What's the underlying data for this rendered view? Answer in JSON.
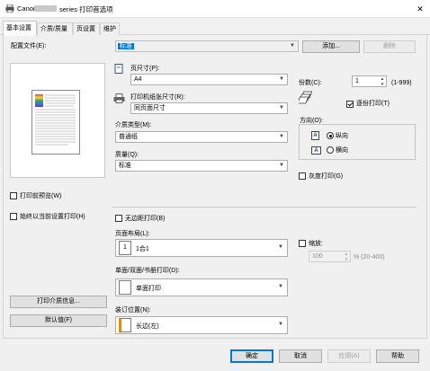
{
  "window": {
    "title_prefix": "Canon",
    "title_suffix": "series 打印首选项",
    "close_glyph": "✕"
  },
  "tabs": [
    {
      "label": "基本设置",
      "active": true
    },
    {
      "label": "介质/质量",
      "active": false
    },
    {
      "label": "页设置",
      "active": false
    },
    {
      "label": "维护",
      "active": false
    }
  ],
  "profile": {
    "label": "配置文件(E):",
    "value": "标准",
    "add_button": "添加...",
    "delete_button": "删除"
  },
  "page_size": {
    "label": "页尺寸(P):",
    "value": "A4"
  },
  "printer_paper_size": {
    "label": "打印机纸张尺寸(R):",
    "value": "同页面尺寸"
  },
  "media_type": {
    "label": "介质类型(M):",
    "value": "普通纸"
  },
  "quality": {
    "label": "质量(Q):",
    "value": "标准"
  },
  "copies": {
    "label": "份数(C):",
    "value": "1",
    "range": "(1-999)"
  },
  "collate": {
    "label": "逐份打印(T)",
    "checked": true
  },
  "orientation": {
    "label": "方向(O):",
    "portrait": "纵向",
    "landscape": "横向",
    "selected": "portrait",
    "icon_glyph": "A"
  },
  "grayscale": {
    "label": "灰度打印(G)",
    "checked": false
  },
  "preview_before": {
    "label": "打印前预览(W)",
    "checked": false
  },
  "always_print_current": {
    "label": "始终以当前设置打印(H)",
    "checked": false
  },
  "borderless": {
    "label": "无边距打印(B)",
    "checked": false
  },
  "page_layout": {
    "label": "页面布局(L):",
    "value": "1合1",
    "icon_text": "1"
  },
  "scaling": {
    "label": "缩放:",
    "value": "100",
    "range": "% (20-400)",
    "checked": false
  },
  "duplex": {
    "label": "单面/双面/书册打印(D):",
    "value": "单面打印"
  },
  "stapling": {
    "label": "装订位置(N):",
    "value": "长边(左)"
  },
  "left_buttons": {
    "media_info": "打印介质信息...",
    "defaults": "默认值(F)"
  },
  "footer_buttons": {
    "ok": "确定",
    "cancel": "取消",
    "apply": "应用(A)",
    "help": "帮助"
  },
  "colors": {
    "accent": "#0078d7",
    "panel": "#f0f0f0",
    "disabled_text": "#a0a0a0",
    "staple_edge": "#e08a1c"
  }
}
